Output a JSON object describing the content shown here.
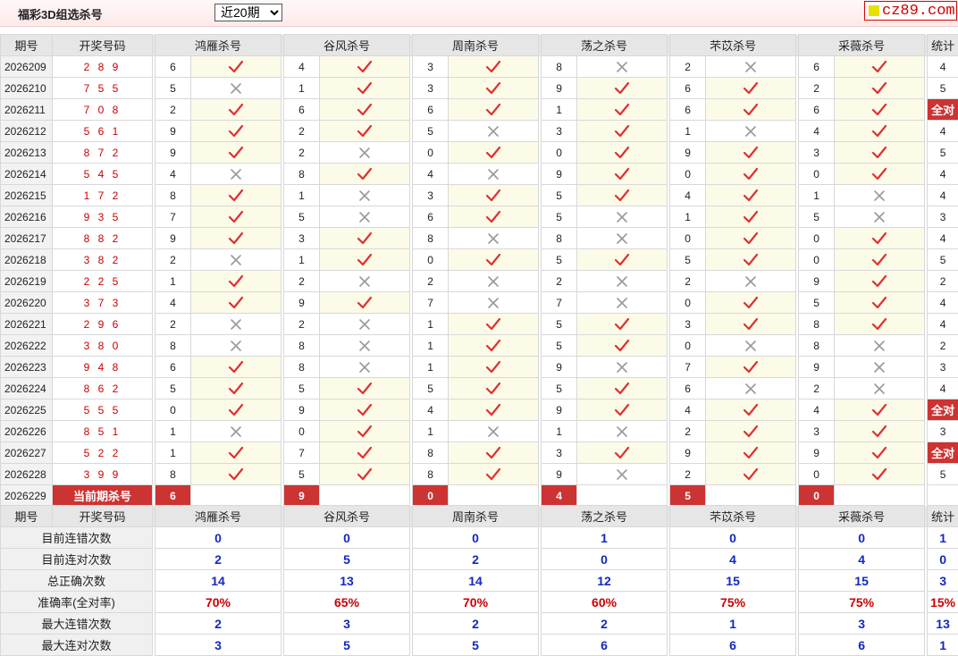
{
  "header": {
    "title": "福彩3D组选杀号",
    "selected_option": "近20期",
    "logo_text": "cz89.com"
  },
  "columns": {
    "period": "期号",
    "winning": "开奖号码",
    "stat": "统计",
    "experts": [
      "鸿雁杀号",
      "谷风杀号",
      "周南杀号",
      "荡之杀号",
      "芣苡杀号",
      "采薇杀号"
    ]
  },
  "rows": [
    {
      "period": "2026209",
      "winning": "2 8 9",
      "kills": [
        [
          "6",
          true
        ],
        [
          "4",
          true
        ],
        [
          "3",
          true
        ],
        [
          "8",
          false
        ],
        [
          "2",
          false
        ],
        [
          "6",
          true
        ]
      ],
      "stat": "4"
    },
    {
      "period": "2026210",
      "winning": "7 5 5",
      "kills": [
        [
          "5",
          false
        ],
        [
          "1",
          true
        ],
        [
          "3",
          true
        ],
        [
          "9",
          true
        ],
        [
          "6",
          true
        ],
        [
          "2",
          true
        ]
      ],
      "stat": "5"
    },
    {
      "period": "2026211",
      "winning": "7 0 8",
      "kills": [
        [
          "2",
          true
        ],
        [
          "6",
          true
        ],
        [
          "6",
          true
        ],
        [
          "1",
          true
        ],
        [
          "6",
          true
        ],
        [
          "6",
          true
        ]
      ],
      "stat": "全对"
    },
    {
      "period": "2026212",
      "winning": "5 6 1",
      "kills": [
        [
          "9",
          true
        ],
        [
          "2",
          true
        ],
        [
          "5",
          false
        ],
        [
          "3",
          true
        ],
        [
          "1",
          false
        ],
        [
          "4",
          true
        ]
      ],
      "stat": "4"
    },
    {
      "period": "2026213",
      "winning": "8 7 2",
      "kills": [
        [
          "9",
          true
        ],
        [
          "2",
          false
        ],
        [
          "0",
          true
        ],
        [
          "0",
          true
        ],
        [
          "9",
          true
        ],
        [
          "3",
          true
        ]
      ],
      "stat": "5"
    },
    {
      "period": "2026214",
      "winning": "5 4 5",
      "kills": [
        [
          "4",
          false
        ],
        [
          "8",
          true
        ],
        [
          "4",
          false
        ],
        [
          "9",
          true
        ],
        [
          "0",
          true
        ],
        [
          "0",
          true
        ]
      ],
      "stat": "4"
    },
    {
      "period": "2026215",
      "winning": "1 7 2",
      "kills": [
        [
          "8",
          true
        ],
        [
          "1",
          false
        ],
        [
          "3",
          true
        ],
        [
          "5",
          true
        ],
        [
          "4",
          true
        ],
        [
          "1",
          false
        ]
      ],
      "stat": "4"
    },
    {
      "period": "2026216",
      "winning": "9 3 5",
      "kills": [
        [
          "7",
          true
        ],
        [
          "5",
          false
        ],
        [
          "6",
          true
        ],
        [
          "5",
          false
        ],
        [
          "1",
          true
        ],
        [
          "5",
          false
        ]
      ],
      "stat": "3"
    },
    {
      "period": "2026217",
      "winning": "8 8 2",
      "kills": [
        [
          "9",
          true
        ],
        [
          "3",
          true
        ],
        [
          "8",
          false
        ],
        [
          "8",
          false
        ],
        [
          "0",
          true
        ],
        [
          "0",
          true
        ]
      ],
      "stat": "4"
    },
    {
      "period": "2026218",
      "winning": "3 8 2",
      "kills": [
        [
          "2",
          false
        ],
        [
          "1",
          true
        ],
        [
          "0",
          true
        ],
        [
          "5",
          true
        ],
        [
          "5",
          true
        ],
        [
          "0",
          true
        ]
      ],
      "stat": "5"
    },
    {
      "period": "2026219",
      "winning": "2 2 5",
      "kills": [
        [
          "1",
          true
        ],
        [
          "2",
          false
        ],
        [
          "2",
          false
        ],
        [
          "2",
          false
        ],
        [
          "2",
          false
        ],
        [
          "9",
          true
        ]
      ],
      "stat": "2"
    },
    {
      "period": "2026220",
      "winning": "3 7 3",
      "kills": [
        [
          "4",
          true
        ],
        [
          "9",
          true
        ],
        [
          "7",
          false
        ],
        [
          "7",
          false
        ],
        [
          "0",
          true
        ],
        [
          "5",
          true
        ]
      ],
      "stat": "4"
    },
    {
      "period": "2026221",
      "winning": "2 9 6",
      "kills": [
        [
          "2",
          false
        ],
        [
          "2",
          false
        ],
        [
          "1",
          true
        ],
        [
          "5",
          true
        ],
        [
          "3",
          true
        ],
        [
          "8",
          true
        ]
      ],
      "stat": "4"
    },
    {
      "period": "2026222",
      "winning": "3 8 0",
      "kills": [
        [
          "8",
          false
        ],
        [
          "8",
          false
        ],
        [
          "1",
          true
        ],
        [
          "5",
          true
        ],
        [
          "0",
          false
        ],
        [
          "8",
          false
        ]
      ],
      "stat": "2"
    },
    {
      "period": "2026223",
      "winning": "9 4 8",
      "kills": [
        [
          "6",
          true
        ],
        [
          "8",
          false
        ],
        [
          "1",
          true
        ],
        [
          "9",
          false
        ],
        [
          "7",
          true
        ],
        [
          "9",
          false
        ]
      ],
      "stat": "3"
    },
    {
      "period": "2026224",
      "winning": "8 6 2",
      "kills": [
        [
          "5",
          true
        ],
        [
          "5",
          true
        ],
        [
          "5",
          true
        ],
        [
          "5",
          true
        ],
        [
          "6",
          false
        ],
        [
          "2",
          false
        ]
      ],
      "stat": "4"
    },
    {
      "period": "2026225",
      "winning": "5 5 5",
      "kills": [
        [
          "0",
          true
        ],
        [
          "9",
          true
        ],
        [
          "4",
          true
        ],
        [
          "9",
          true
        ],
        [
          "4",
          true
        ],
        [
          "4",
          true
        ]
      ],
      "stat": "全对"
    },
    {
      "period": "2026226",
      "winning": "8 5 1",
      "kills": [
        [
          "1",
          false
        ],
        [
          "0",
          true
        ],
        [
          "1",
          false
        ],
        [
          "1",
          false
        ],
        [
          "2",
          true
        ],
        [
          "3",
          true
        ]
      ],
      "stat": "3"
    },
    {
      "period": "2026227",
      "winning": "5 2 2",
      "kills": [
        [
          "1",
          true
        ],
        [
          "7",
          true
        ],
        [
          "8",
          true
        ],
        [
          "3",
          true
        ],
        [
          "9",
          true
        ],
        [
          "9",
          true
        ]
      ],
      "stat": "全对"
    },
    {
      "period": "2026228",
      "winning": "3 9 9",
      "kills": [
        [
          "8",
          true
        ],
        [
          "5",
          true
        ],
        [
          "8",
          true
        ],
        [
          "9",
          false
        ],
        [
          "2",
          true
        ],
        [
          "0",
          true
        ]
      ],
      "stat": "5"
    }
  ],
  "current": {
    "period": "2026229",
    "label": "当前期杀号",
    "kills": [
      "6",
      "9",
      "0",
      "4",
      "5",
      "0"
    ]
  },
  "stats": [
    {
      "label": "目前连错次数",
      "values": [
        "0",
        "0",
        "0",
        "1",
        "0",
        "0"
      ],
      "stat": "1",
      "rate": false
    },
    {
      "label": "目前连对次数",
      "values": [
        "2",
        "5",
        "2",
        "0",
        "4",
        "4"
      ],
      "stat": "0",
      "rate": false
    },
    {
      "label": "总正确次数",
      "values": [
        "14",
        "13",
        "14",
        "12",
        "15",
        "15"
      ],
      "stat": "3",
      "rate": false
    },
    {
      "label": "准确率(全对率)",
      "values": [
        "70%",
        "65%",
        "70%",
        "60%",
        "75%",
        "75%"
      ],
      "stat": "15%",
      "rate": true
    },
    {
      "label": "最大连错次数",
      "values": [
        "2",
        "3",
        "2",
        "2",
        "1",
        "3"
      ],
      "stat": "13",
      "rate": false
    },
    {
      "label": "最大连对次数",
      "values": [
        "3",
        "5",
        "5",
        "6",
        "6",
        "6"
      ],
      "stat": "1",
      "rate": false
    }
  ],
  "colors": {
    "accent": "#cc3333",
    "ok_mark": "#e03030",
    "no_mark": "#999999",
    "stat_blue": "#1428c0"
  },
  "icons": {
    "ok": "check-icon",
    "no": "cross-icon"
  }
}
